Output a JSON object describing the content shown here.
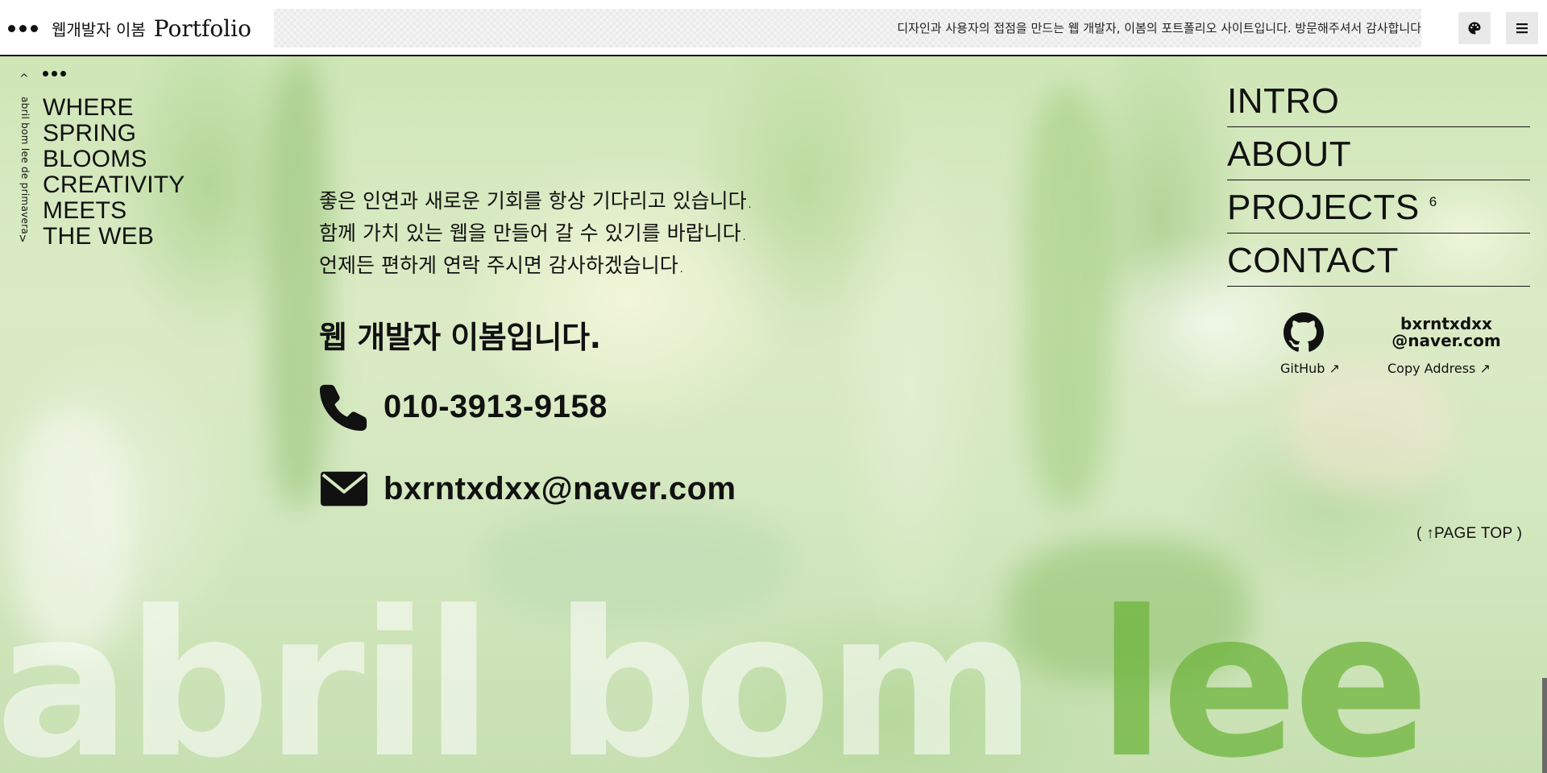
{
  "header": {
    "title_ko": "웹개발자 이봄",
    "title_en": "Portfolio",
    "marquee": "디자인과 사용자의 접점을 만드는 웹 개발자, 이봄의 포트폴리오 사이트입니다. 방문해주셔서 감사합니다",
    "theme_icon": "palette-icon",
    "menu_icon": "hamburger-menu-icon"
  },
  "side": {
    "vertical_text": "abril bom lee de primavera",
    "up_arrow": "^",
    "down_arrow": "v",
    "slogan": [
      "WHERE",
      "SPRING",
      "BLOOMS",
      "CREATIVITY",
      "MEETS",
      "THE WEB"
    ]
  },
  "contact": {
    "message": [
      "좋은 인연과 새로운 기회를 항상 기다리고 있습니다.",
      "함께 가치 있는 웹을 만들어 갈 수 있기를 바랍니다.",
      "언제든 편하게 연락 주시면 감사하겠습니다."
    ],
    "intro": "웹 개발자 이봄입니다.",
    "phone": "010-3913-9158",
    "email": "bxrntxdxx@naver.com"
  },
  "nav": {
    "items": [
      {
        "label": "INTRO"
      },
      {
        "label": "ABOUT"
      },
      {
        "label": "PROJECTS",
        "count": "6"
      },
      {
        "label": "CONTACT"
      }
    ]
  },
  "links": {
    "github_label": "GitHub ↗",
    "email_line1": "bxrntxdxx",
    "email_line2": "@naver.com",
    "copy_label": "Copy Address ↗"
  },
  "page_top": "( ↑PAGE TOP )",
  "wordmark": {
    "part1": "abril bom ",
    "part2": "lee"
  },
  "colors": {
    "text": "#111111",
    "background_green": "#d4e8c0",
    "accent_green": "#6eb43c"
  }
}
